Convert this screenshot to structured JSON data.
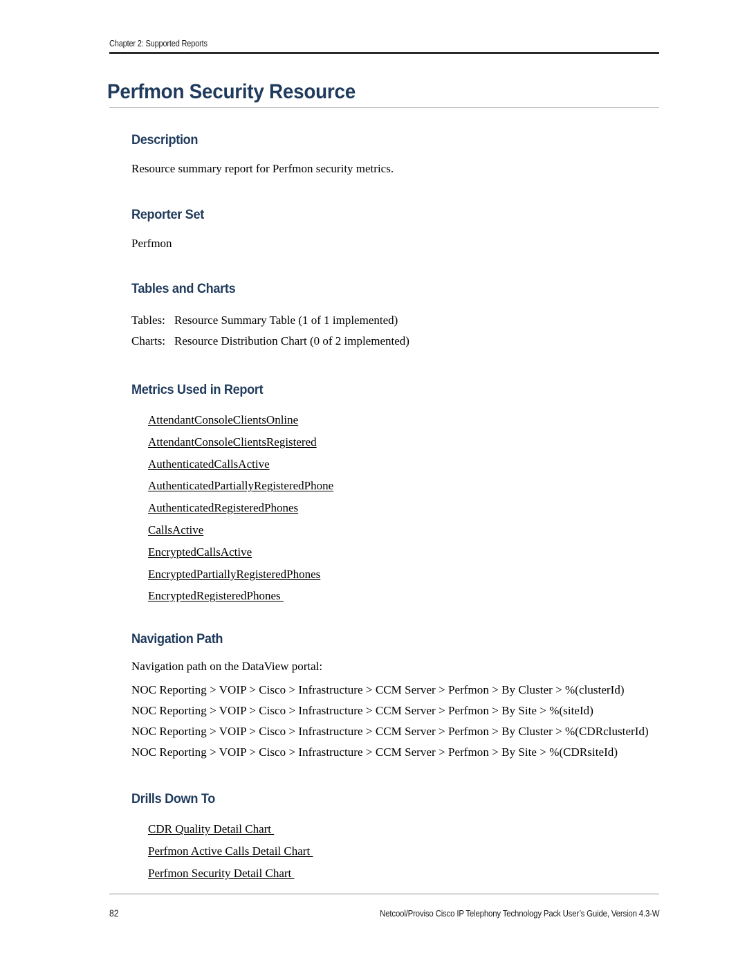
{
  "header": {
    "chapter": "Chapter 2: Supported Reports"
  },
  "title": "Perfmon Security Resource",
  "sections": {
    "description": {
      "heading": "Description",
      "text": "Resource summary report for Perfmon security metrics."
    },
    "reporter_set": {
      "heading": "Reporter Set",
      "text": "Perfmon"
    },
    "tables_and_charts": {
      "heading": "Tables and Charts",
      "rows": [
        {
          "label": "Tables:",
          "value": "Resource Summary Table (1 of 1 implemented)"
        },
        {
          "label": "Charts:",
          "value": "Resource Distribution Chart (0 of 2 implemented)"
        }
      ]
    },
    "metrics_used": {
      "heading": "Metrics Used in Report",
      "items": [
        "AttendantConsoleClientsOnline",
        "AttendantConsoleClientsRegistered",
        "AuthenticatedCallsActive",
        "AuthenticatedPartiallyRegisteredPhone",
        "AuthenticatedRegisteredPhones",
        "CallsActive",
        "EncryptedCallsActive",
        "EncryptedPartiallyRegisteredPhones",
        "EncryptedRegisteredPhones "
      ]
    },
    "navigation_path": {
      "heading": "Navigation Path",
      "intro": "Navigation path on the DataView portal:",
      "paths": [
        "NOC Reporting >  VOIP >  Cisco >  Infrastructure >  CCM Server >  Perfmon >  By Cluster >  %(clusterId)",
        "NOC Reporting >  VOIP >  Cisco >  Infrastructure >  CCM Server >  Perfmon >  By Site >  %(siteId)",
        "NOC Reporting >  VOIP >  Cisco >  Infrastructure >  CCM Server >  Perfmon >  By Cluster >  %(CDRclusterId)",
        "NOC Reporting >  VOIP >  Cisco >  Infrastructure >  CCM Server >  Perfmon >  By Site >  %(CDRsiteId)"
      ]
    },
    "drills_down_to": {
      "heading": "Drills Down To",
      "items": [
        "CDR Quality Detail Chart ",
        "Perfmon Active Calls Detail Chart ",
        "Perfmon Security Detail Chart "
      ]
    }
  },
  "footer": {
    "page_number": "82",
    "guide": "Netcool/Proviso Cisco IP Telephony Technology Pack User’s Guide, Version 4.3-W"
  },
  "colors": {
    "heading": "#1f3a5c",
    "header_rule": "#2a2a2a",
    "title_rule": "#b9b9b9",
    "footer_rule": "#8f8f8f",
    "body_text": "#000000"
  }
}
